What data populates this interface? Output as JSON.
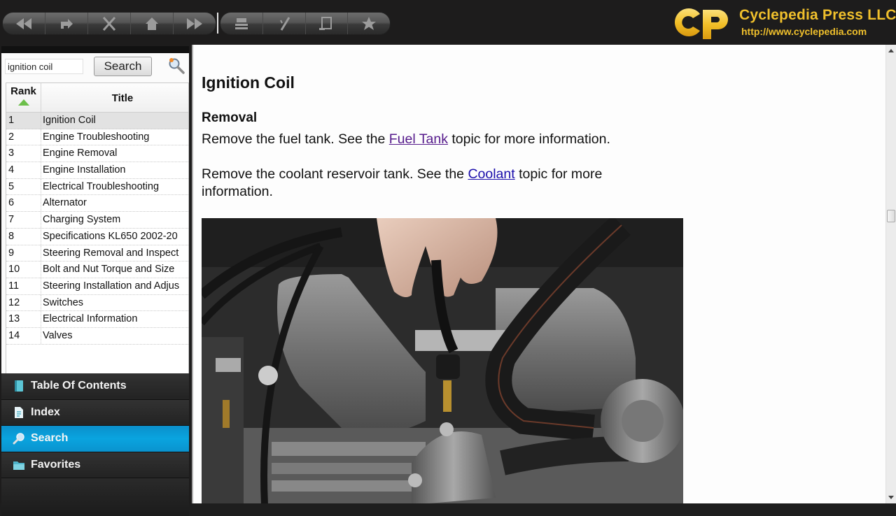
{
  "toolbar": {
    "nav_buttons": [
      {
        "name": "back",
        "icon": "rewind-icon"
      },
      {
        "name": "refresh",
        "icon": "refresh-icon"
      },
      {
        "name": "stop",
        "icon": "close-icon"
      },
      {
        "name": "home",
        "icon": "home-icon"
      },
      {
        "name": "forward",
        "icon": "fast-forward-icon"
      }
    ],
    "tool_buttons": [
      {
        "name": "print",
        "icon": "print-icon"
      },
      {
        "name": "highlight",
        "icon": "pen-icon"
      },
      {
        "name": "window",
        "icon": "window-icon"
      },
      {
        "name": "favorite",
        "icon": "star-icon"
      }
    ]
  },
  "brand": {
    "mark": "CP",
    "name": "Cyclepedia Press LLC",
    "url": "http://www.cyclepedia.com",
    "color": "#f0c02c"
  },
  "search": {
    "query": "ignition coil",
    "button_label": "Search"
  },
  "results": {
    "columns": {
      "rank": "Rank",
      "title": "Title"
    },
    "rows": [
      {
        "rank": "1",
        "title": "Ignition Coil"
      },
      {
        "rank": "2",
        "title": "Engine Troubleshooting"
      },
      {
        "rank": "3",
        "title": "Engine Removal"
      },
      {
        "rank": "4",
        "title": "Engine Installation"
      },
      {
        "rank": "5",
        "title": "Electrical Troubleshooting"
      },
      {
        "rank": "6",
        "title": "Alternator"
      },
      {
        "rank": "7",
        "title": "Charging System"
      },
      {
        "rank": "8",
        "title": "Specifications KL650 2002-20"
      },
      {
        "rank": "9",
        "title": "Steering Removal and Inspect"
      },
      {
        "rank": "10",
        "title": "Bolt and Nut Torque and Size"
      },
      {
        "rank": "11",
        "title": "Steering Installation and Adjus"
      },
      {
        "rank": "12",
        "title": "Switches"
      },
      {
        "rank": "13",
        "title": "Electrical Information"
      },
      {
        "rank": "14",
        "title": "Valves"
      }
    ],
    "selected_index": 0,
    "hscroll_grip": "III"
  },
  "nav": {
    "items": [
      {
        "label": "Table Of Contents",
        "icon": "book-icon"
      },
      {
        "label": "Index",
        "icon": "document-icon"
      },
      {
        "label": "Search",
        "icon": "magnifier-icon"
      },
      {
        "label": "Favorites",
        "icon": "folder-icon"
      }
    ],
    "active": "Search",
    "active_color": "#0a9ad6"
  },
  "article": {
    "title": "Ignition Coil",
    "section": "Removal",
    "p1": {
      "before": "Remove the fuel tank. See the ",
      "link": "Fuel Tank",
      "after": " topic for more information."
    },
    "p2": {
      "before": "Remove the coolant reservoir tank. See the ",
      "link": "Coolant",
      "after": " topic for more information."
    },
    "image_alt": "Engine cylinder heads with hand disconnecting ignition coil lead"
  }
}
